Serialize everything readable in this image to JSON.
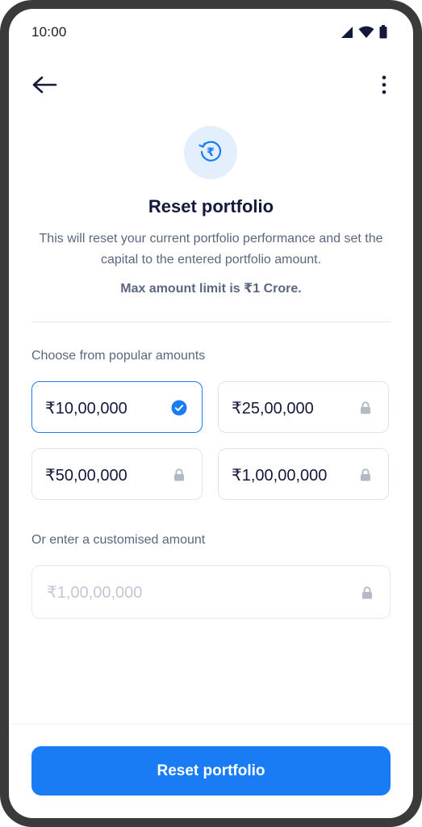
{
  "status_bar": {
    "time": "10:00",
    "icons": [
      "signal-icon",
      "wifi-icon",
      "battery-icon"
    ]
  },
  "app_bar": {
    "back_icon": "arrow-left-icon",
    "menu_icon": "more-vertical-icon"
  },
  "hero": {
    "icon": "rupee-reset-icon",
    "title": "Reset portfolio",
    "description": "This will reset your current portfolio performance and set the capital to the entered portfolio amount.",
    "limit_text": "Max amount limit is ₹1 Crore."
  },
  "popular": {
    "label": "Choose from popular amounts",
    "amounts": [
      {
        "label": "₹10,00,000",
        "selected": true,
        "locked": false
      },
      {
        "label": "₹25,00,000",
        "selected": false,
        "locked": true
      },
      {
        "label": "₹50,00,000",
        "selected": false,
        "locked": true
      },
      {
        "label": "₹1,00,00,000",
        "selected": false,
        "locked": true
      }
    ]
  },
  "custom": {
    "label": "Or enter a customised amount",
    "placeholder": "₹1,00,00,000",
    "value": "",
    "locked": true
  },
  "footer": {
    "button_label": "Reset portfolio"
  },
  "colors": {
    "accent": "#1a7cf5",
    "title": "#14193a",
    "body_text": "#5b6680",
    "icon_bg": "#e3effc",
    "lock": "#b3bac6"
  }
}
